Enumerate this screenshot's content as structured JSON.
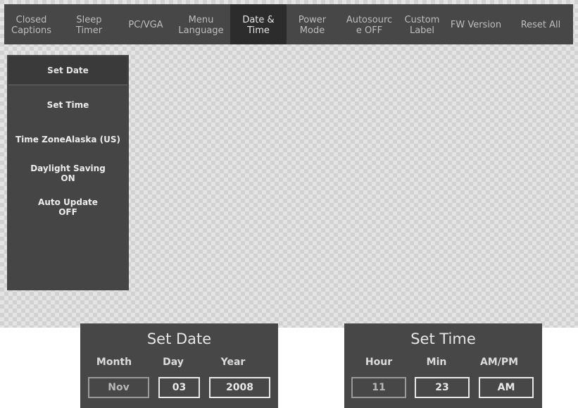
{
  "top_menu": {
    "tabs": [
      {
        "label": "Closed\nCaptions"
      },
      {
        "label": "Sleep\nTimer"
      },
      {
        "label": "PC/VGA"
      },
      {
        "label": "Menu\nLanguage"
      },
      {
        "label": "Date &\nTime"
      },
      {
        "label": "Power\nMode"
      },
      {
        "label": "Autosourc\ne OFF"
      },
      {
        "label": "Custom\nLabel"
      },
      {
        "label": "FW Version"
      },
      {
        "label": "Reset All"
      }
    ],
    "active_tab": "Date & Time"
  },
  "submenu": {
    "items": [
      {
        "label": "Set Date"
      },
      {
        "label": "Set Time"
      },
      {
        "label": "Time ZoneAlaska (US)"
      },
      {
        "label": "Daylight Saving\nON"
      },
      {
        "label": "Auto Update\nOFF"
      }
    ],
    "selected": "Set Date"
  },
  "set_date_panel": {
    "title": "Set Date",
    "month_label": "Month",
    "day_label": "Day",
    "year_label": "Year",
    "month_value": "Nov",
    "day_value": "03",
    "year_value": "2008"
  },
  "set_time_panel": {
    "title": "Set Time",
    "hour_label": "Hour",
    "min_label": "Min",
    "ampm_label": "AM/PM",
    "hour_value": "11",
    "min_value": "23",
    "ampm_value": "AM"
  }
}
